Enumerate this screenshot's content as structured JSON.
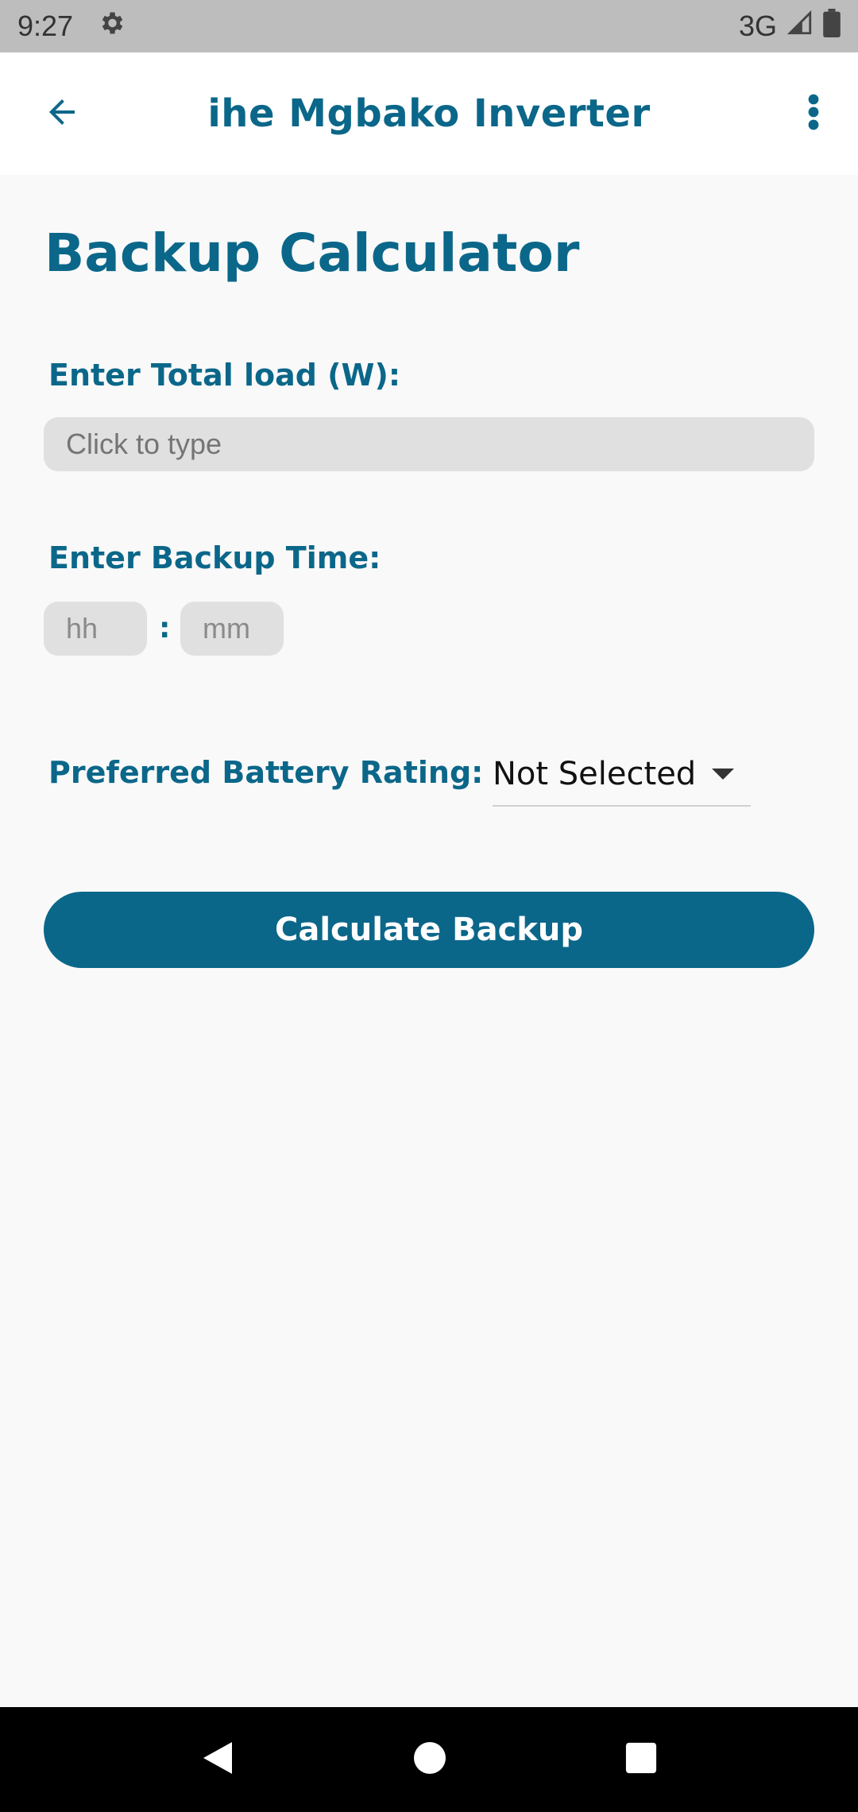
{
  "status_bar": {
    "time": "9:27",
    "network": "3G"
  },
  "app_bar": {
    "title": "ihe Mgbako Inverter",
    "back_icon": "arrow-left-icon",
    "menu_icon": "more-vert-icon"
  },
  "page": {
    "title": "Backup Calculator"
  },
  "form": {
    "load_label": "Enter Total load (W):",
    "load_placeholder": "Click to type",
    "backup_time_label": "Enter Backup Time:",
    "hours_placeholder": "hh",
    "time_separator": ":",
    "minutes_placeholder": "mm",
    "battery_label": "Preferred Battery Rating:",
    "battery_selected": "Not Selected"
  },
  "actions": {
    "calculate_label": "Calculate Backup"
  },
  "colors": {
    "primary": "#0b6789",
    "background": "#f9f9f9",
    "input_bg": "#e0e0e0"
  }
}
